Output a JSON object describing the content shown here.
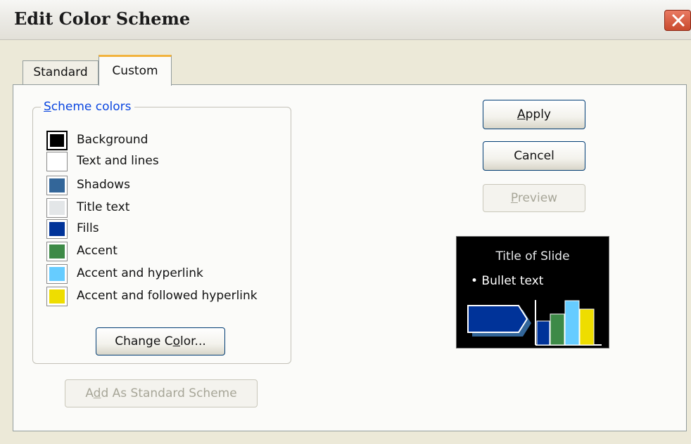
{
  "dialog": {
    "title": "Edit Color Scheme"
  },
  "tabs": [
    {
      "label": "Standard",
      "active": false
    },
    {
      "label": "Custom",
      "active": true
    }
  ],
  "scheme_colors": {
    "legend_key": "S",
    "legend_rest": "cheme colors",
    "items": [
      {
        "label": "Background",
        "color": "#000000",
        "selected": true
      },
      {
        "label": "Text and lines",
        "color": "#ffffff",
        "selected": false
      },
      {
        "label": "Shadows",
        "color": "#336699",
        "selected": false
      },
      {
        "label": "Title text",
        "color": "#e3e6e8",
        "selected": false
      },
      {
        "label": "Fills",
        "color": "#003399",
        "selected": false
      },
      {
        "label": "Accent",
        "color": "#3d8a47",
        "selected": false
      },
      {
        "label": "Accent and hyperlink",
        "color": "#66ccff",
        "selected": false
      },
      {
        "label": "Accent and followed hyperlink",
        "color": "#eedd00",
        "selected": false
      }
    ]
  },
  "buttons": {
    "apply_key": "A",
    "apply_rest": "pply",
    "cancel": "Cancel",
    "preview_key": "P",
    "preview_rest": "review",
    "change_pre": "Change C",
    "change_key": "o",
    "change_post": "lor...",
    "addstd_pre": "A",
    "addstd_key": "d",
    "addstd_post": "d As Standard Scheme"
  },
  "preview": {
    "title": "Title of Slide",
    "bullet": "• Bullet text"
  }
}
